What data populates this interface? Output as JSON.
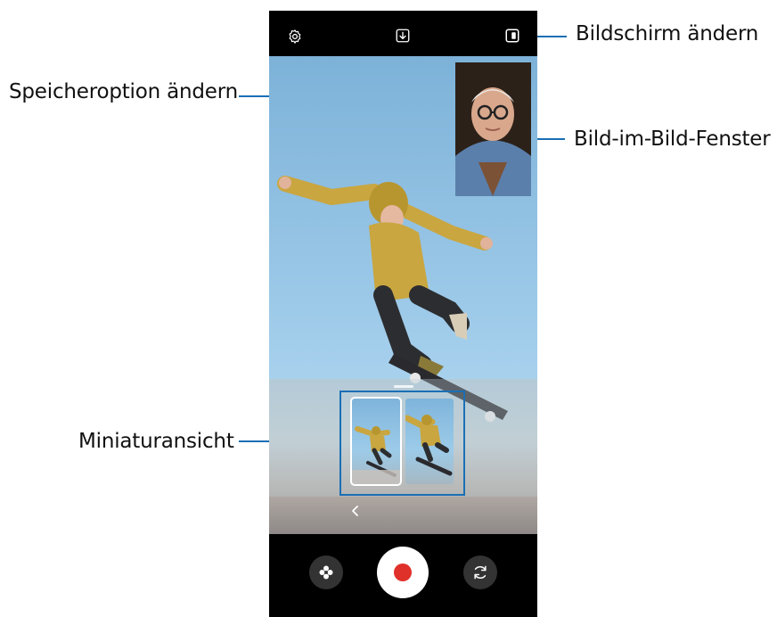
{
  "callouts": {
    "change_screen": "Bildschirm ändern",
    "change_save_option": "Speicheroption ändern",
    "pip_window": "Bild-im-Bild-Fenster",
    "thumbnail_view": "Miniaturansicht"
  },
  "icons": {
    "settings": "gear-icon",
    "save_option": "download-icon",
    "change_screen": "screen-layout-icon",
    "effects": "flower-icon",
    "record": "record-icon",
    "switch_camera": "switch-camera-icon",
    "collapse": "chevron-left-icon"
  },
  "colors": {
    "callout_line": "#1a6fb5",
    "record": "#e0302a",
    "phone_background": "#000000"
  }
}
